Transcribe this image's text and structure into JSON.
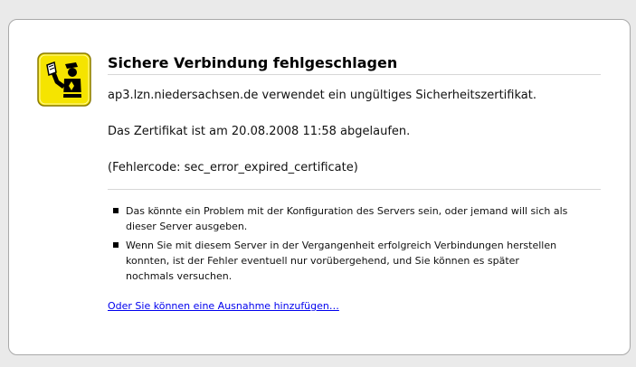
{
  "error_page": {
    "title": "Sichere Verbindung fehlgeschlagen",
    "short_description": "ap3.lzn.niedersachsen.de verwendet ein ungültiges Sicherheitszertifikat.",
    "expiry_text": "Das Zertifikat ist am 20.08.2008 11:58 abgelaufen.",
    "error_code": "(Fehlercode: sec_error_expired_certificate)",
    "advice": [
      "Das könnte ein Problem mit der Konfiguration des Servers sein, oder jemand will sich als dieser Server ausgeben.",
      "Wenn Sie mit diesem Server in der Vergangenheit erfolgreich Verbindungen herstellen konnten, ist der Fehler eventuell nur vorübergehend, und Sie können es später nochmals versuchen."
    ],
    "exception_link": "Oder Sie können eine Ausnahme hinzufügen…",
    "icon": "certificate-warning-icon"
  },
  "colors": {
    "page_background": "#eaeaea",
    "box_background": "#ffffff",
    "box_border": "#a9a9a9",
    "icon_yellow": "#f5e400",
    "link": "#0000ee"
  }
}
